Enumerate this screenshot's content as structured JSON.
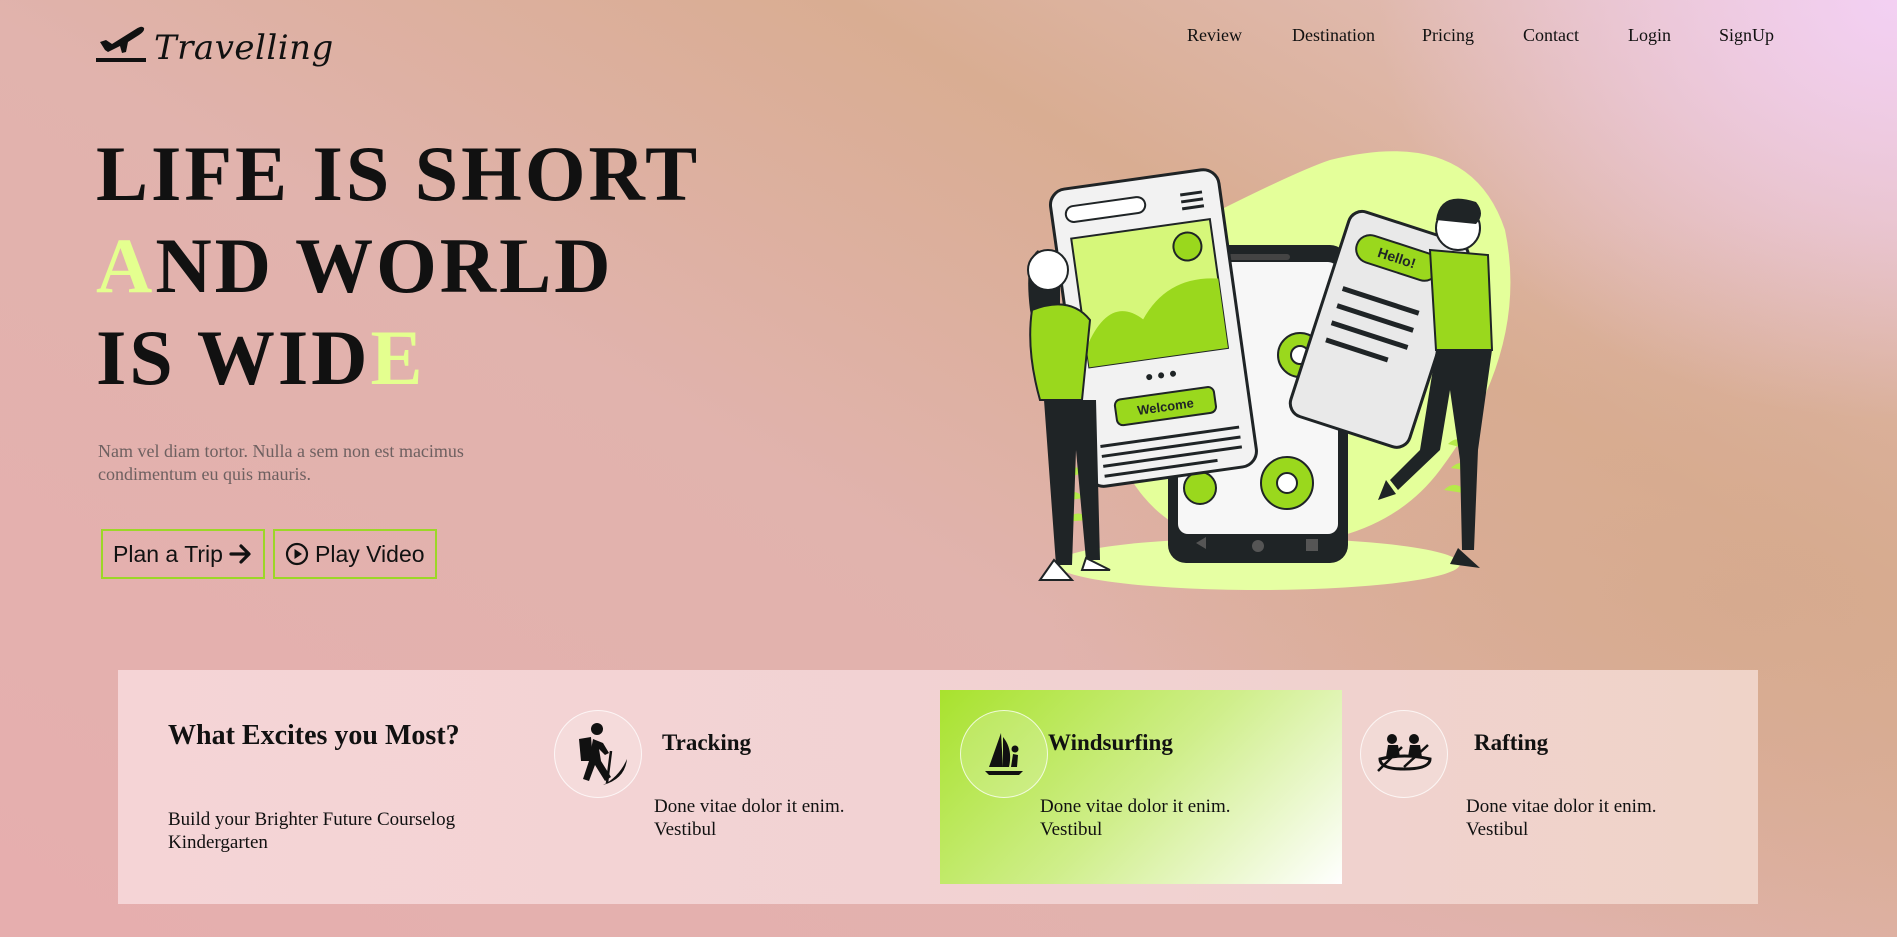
{
  "brand": {
    "name": "Travelling",
    "logo_icon": "airplane-icon"
  },
  "nav": {
    "items": [
      "Review",
      "Destination",
      "Pricing",
      "Contact",
      "Login",
      "SignUp"
    ]
  },
  "hero": {
    "line1": "LIFE IS SHORT",
    "line2_accent": "A",
    "line2_rest": "ND WORLD",
    "line3_rest": "IS WID",
    "line3_accent": "E",
    "subtitle": "Nam vel diam tortor. Nulla a sem non est macimus condimentum eu quis mauris.",
    "plan_label": "Plan a Trip",
    "plan_icon": "arrow-right-icon",
    "video_label": "Play Video",
    "video_icon": "play-circle-icon",
    "illustration_text": {
      "greeting": "Hello!",
      "welcome": "Welcome"
    }
  },
  "features": {
    "title": "What Excites you Most?",
    "description": "Build your Brighter Future Courselog Kindergarten",
    "cards": [
      {
        "title": "Tracking",
        "text": "Done vitae dolor it enim. Vestibul",
        "icon": "hiker-icon"
      },
      {
        "title": "Windsurfing",
        "text": "Done vitae dolor it enim. Vestibul",
        "icon": "windsurf-icon",
        "active": true
      },
      {
        "title": "Rafting",
        "text": "Done vitae dolor it enim. Vestibul",
        "icon": "raft-icon"
      }
    ]
  },
  "colors": {
    "accent": "#e4ff8f",
    "lime": "#9cd727",
    "text": "#111111"
  }
}
